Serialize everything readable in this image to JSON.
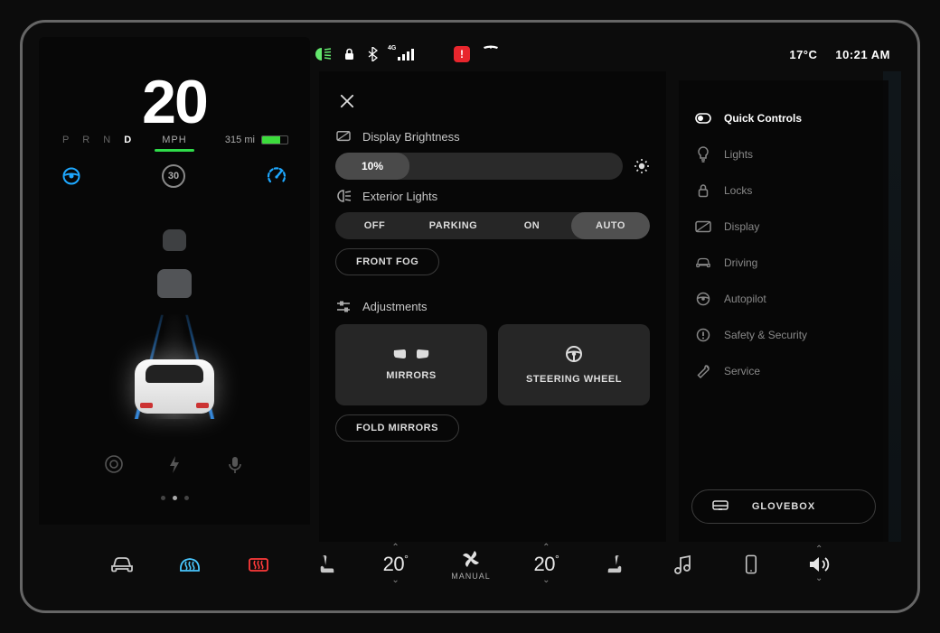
{
  "status": {
    "temperature": "17°C",
    "time": "10:21 AM",
    "signal_label": "4G"
  },
  "cluster": {
    "speed": "20",
    "speed_unit": "MPH",
    "gear_p": "P",
    "gear_r": "R",
    "gear_n": "N",
    "gear_d": "D",
    "range": "315 mi",
    "speed_limit": "30"
  },
  "quick": {
    "brightness_label": "Display Brightness",
    "brightness_value": "10%",
    "exterior_lights_label": "Exterior Lights",
    "lights_off": "OFF",
    "lights_parking": "PARKING",
    "lights_on": "ON",
    "lights_auto": "AUTO",
    "front_fog": "FRONT FOG",
    "adjustments_label": "Adjustments",
    "mirrors": "MIRRORS",
    "steering": "STEERING WHEEL",
    "fold_mirrors": "FOLD MIRRORS"
  },
  "sidebar": {
    "quick": "Quick Controls",
    "lights": "Lights",
    "locks": "Locks",
    "display": "Display",
    "driving": "Driving",
    "autopilot": "Autopilot",
    "safety": "Safety & Security",
    "service": "Service",
    "glovebox": "GLOVEBOX"
  },
  "dock": {
    "temp_left": "20",
    "temp_right": "20",
    "fan_mode": "MANUAL"
  }
}
